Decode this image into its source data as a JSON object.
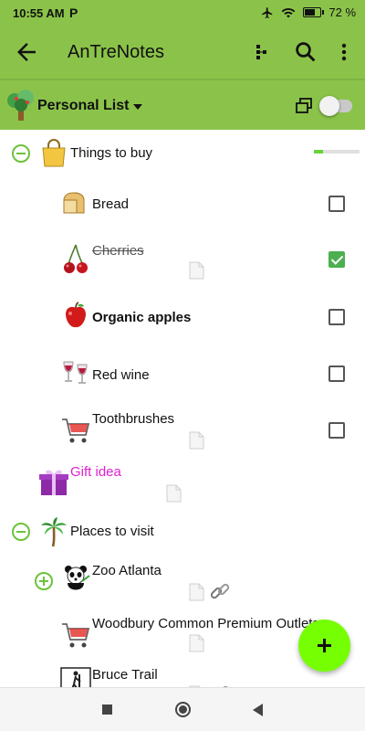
{
  "status_bar": {
    "time": "10:55 AM",
    "notification_icon": "P",
    "battery": "72",
    "battery_percent": 72,
    "icons": [
      "airplane-mode-icon",
      "wifi-icon",
      "battery-charging-icon"
    ]
  },
  "app_bar": {
    "title": "AnTreNotes",
    "actions": [
      "back-arrow-icon",
      "tree-structure-icon",
      "search-icon",
      "more-vert-icon"
    ],
    "color": "#8bc34a"
  },
  "list_bar": {
    "list_name": "Personal List",
    "switch_on": false
  },
  "items": {
    "things_to_buy": {
      "label": "Things to buy",
      "expanded": true,
      "progress": 0.2
    },
    "bread": {
      "label": "Bread",
      "checked": false
    },
    "cherries": {
      "label": "Cherries",
      "checked": true,
      "has_note": true
    },
    "organic_apples": {
      "label": "Organic apples",
      "checked": false
    },
    "red_wine": {
      "label": "Red wine",
      "checked": false
    },
    "toothbrushes": {
      "label": "Toothbrushes",
      "checked": false,
      "has_note": true
    },
    "gift_idea": {
      "label": "Gift idea",
      "color": "#e020d0",
      "has_note": true
    },
    "places_to_visit": {
      "label": "Places to visit",
      "expanded": true
    },
    "zoo_atlanta": {
      "label": "Zoo Atlanta",
      "expanded": false,
      "has_note": true,
      "has_link": true
    },
    "woodbury": {
      "label": "Woodbury Common Premium Outlets",
      "has_note": true
    },
    "bruce_trail": {
      "label": "Bruce Trail",
      "has_note": true,
      "has_link": true
    }
  },
  "colors": {
    "accent": "#8bc34a",
    "fab": "#76ff03",
    "check": "#4caf50",
    "toggle": "#6cc33a"
  }
}
